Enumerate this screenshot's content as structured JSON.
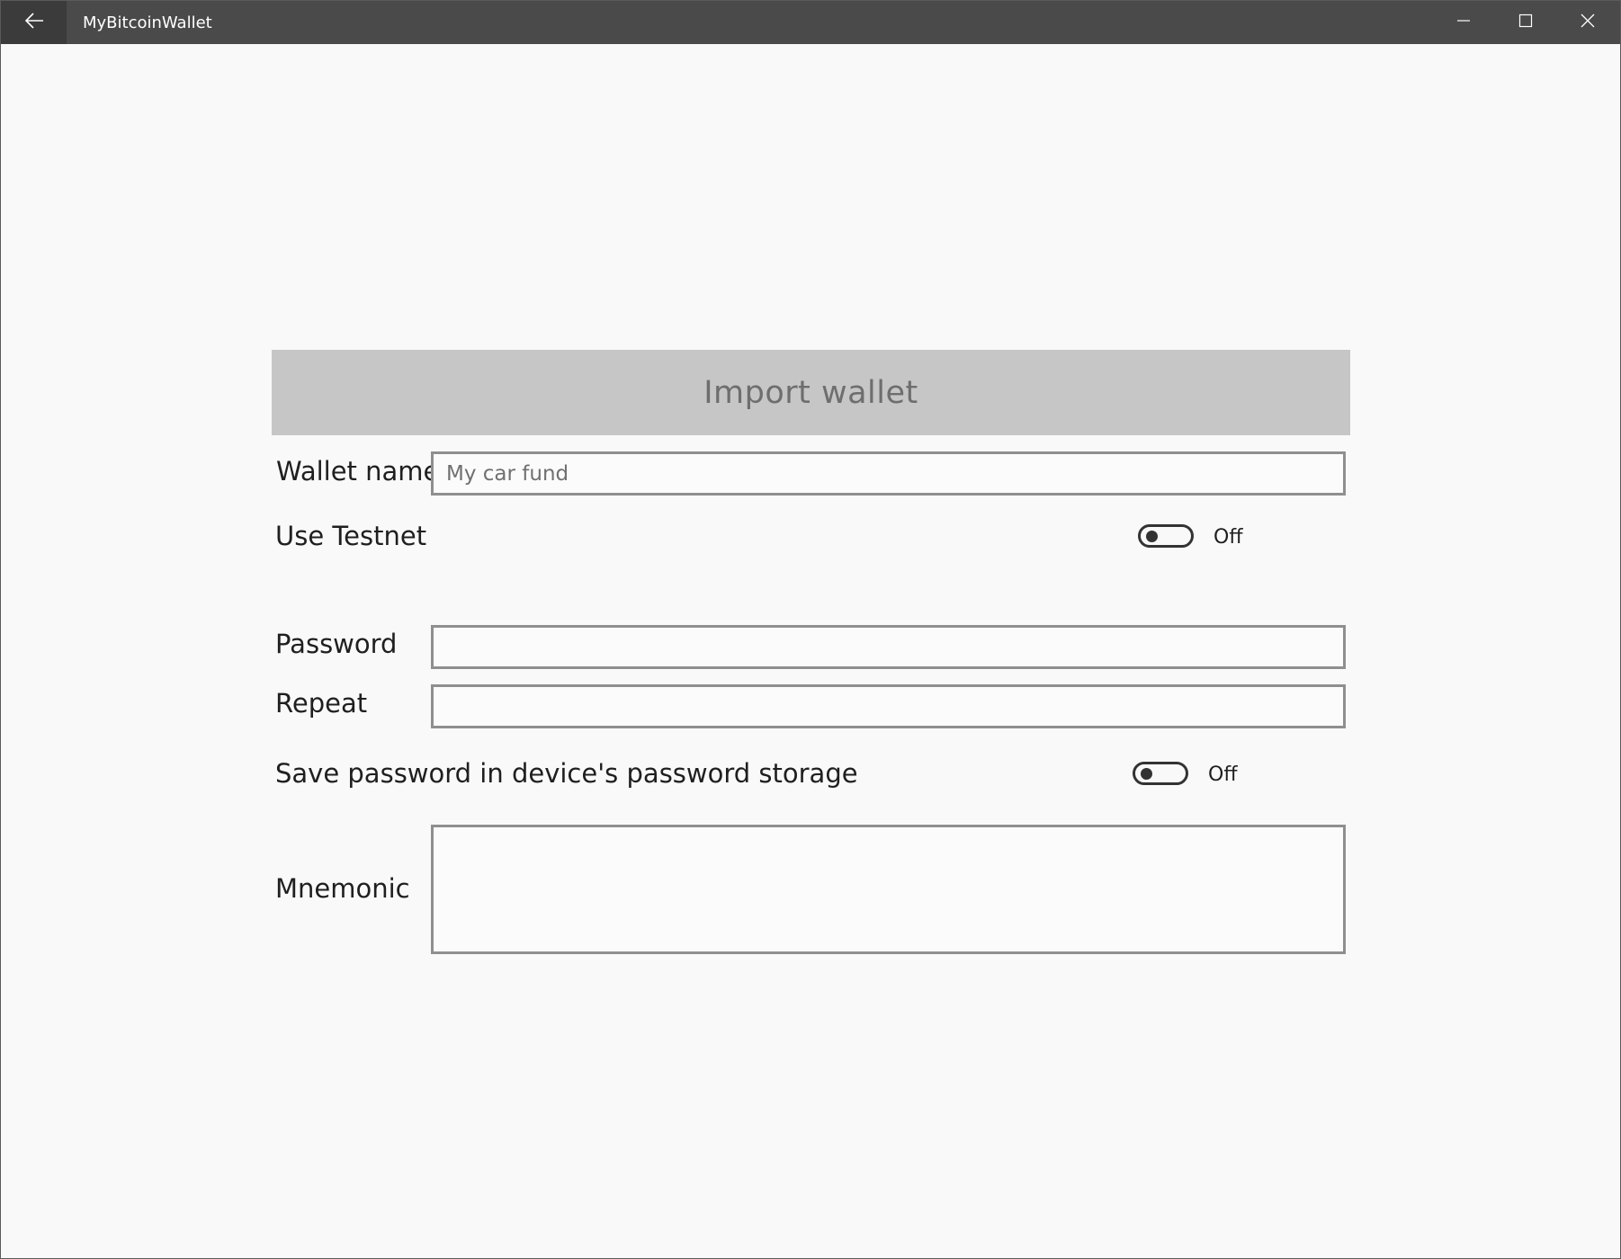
{
  "window": {
    "title": "MyBitcoinWallet"
  },
  "icons": {
    "back": "arrow-left-icon",
    "minimize": "minimize-icon",
    "maximize": "maximize-icon",
    "close": "close-icon"
  },
  "form": {
    "header": "Import wallet",
    "wallet_name": {
      "label": "Wallet name",
      "placeholder": "My car fund",
      "value": ""
    },
    "use_testnet": {
      "label": "Use Testnet",
      "state": "Off"
    },
    "password": {
      "label": "Password",
      "value": ""
    },
    "repeat": {
      "label": "Repeat",
      "value": ""
    },
    "save_password": {
      "label": "Save password in device's password storage",
      "state": "Off"
    },
    "mnemonic": {
      "label": "Mnemonic",
      "value": ""
    }
  },
  "colors": {
    "titlebar": "#4a4a4a",
    "back_button": "#3b3b3b",
    "background": "#f9f9f9",
    "header_banner": "#c6c6c6",
    "header_text": "#6e6e6e",
    "input_border": "#8f8f8f"
  }
}
